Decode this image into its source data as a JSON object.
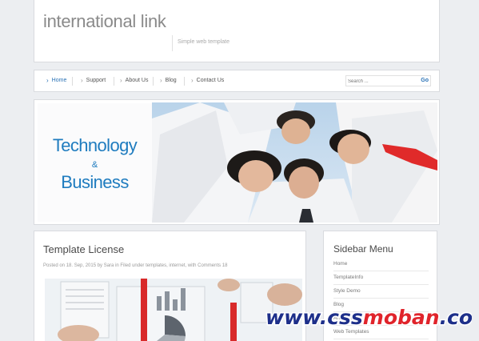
{
  "header": {
    "title": "international link",
    "tagline": "Simple web template"
  },
  "nav": {
    "items": [
      {
        "label": "Home",
        "active": true
      },
      {
        "label": "Support"
      },
      {
        "label": "About Us"
      },
      {
        "label": "Blog"
      },
      {
        "label": "Contact Us"
      }
    ],
    "search_placeholder": "Search ...",
    "search_button": "Go"
  },
  "banner": {
    "line1": "Technology",
    "line2": "&",
    "line3": "Business"
  },
  "post": {
    "title": "Template License",
    "meta": "Posted on 18. Sep, 2015 by Sara in Filed under templates, internet, with Comments 18"
  },
  "sidebar": {
    "title": "Sidebar Menu",
    "items": [
      "Home",
      "TemplateInfo",
      "Style Demo",
      "Blog",
      "Archives",
      "Web Templates"
    ]
  },
  "watermark": {
    "part1": "www.css",
    "part2": "moban",
    "part3": ".com"
  },
  "colors": {
    "accent": "#2b73b6",
    "banner_text": "#1f7cbf",
    "watermark_blue": "#1d2f8a",
    "watermark_red": "#e0242b"
  }
}
